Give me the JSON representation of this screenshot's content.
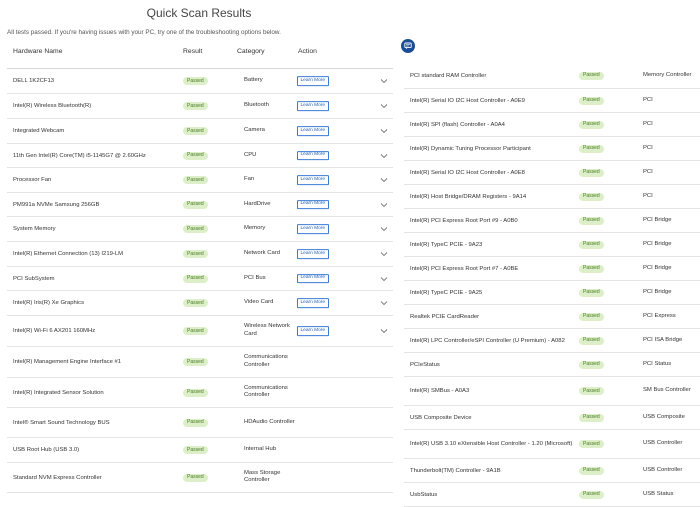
{
  "page": {
    "title": "Quick Scan Results",
    "subtitle": "All tests passed. If you're having issues with your PC, try one of the troubleshooting options below."
  },
  "table": {
    "headers": {
      "name": "Hardware Name",
      "result": "Result",
      "category": "Category",
      "action": "Action"
    },
    "learn_more_label": "Learn More"
  },
  "left_rows": [
    {
      "name": "DELL 1K2CF13",
      "result": "Passed",
      "category": "Battery",
      "learn_more": true,
      "expand": true,
      "h": 24
    },
    {
      "name": "Intel(R) Wireless Bluetooth(R)",
      "result": "Passed",
      "category": "Bluetooth",
      "learn_more": true,
      "expand": true,
      "h": 24
    },
    {
      "name": "Integrated Webcam",
      "result": "Passed",
      "category": "Camera",
      "learn_more": true,
      "expand": true,
      "h": 24
    },
    {
      "name": "11th Gen Intel(R) Core(TM) i5-1145G7 @ 2.60GHz",
      "result": "Passed",
      "category": "CPU",
      "learn_more": true,
      "expand": true,
      "h": 23
    },
    {
      "name": "Processor Fan",
      "result": "Passed",
      "category": "Fan",
      "learn_more": true,
      "expand": true,
      "h": 24
    },
    {
      "name": "PM991a NVMe Samsung 256GB",
      "result": "Passed",
      "category": "HardDrive",
      "learn_more": true,
      "expand": true,
      "h": 23
    },
    {
      "name": "System Memory",
      "result": "Passed",
      "category": "Memory",
      "learn_more": true,
      "expand": true,
      "h": 24
    },
    {
      "name": "Intel(R) Ethernet Connection (13) I219-LM",
      "result": "Passed",
      "category": "Network Card",
      "learn_more": true,
      "expand": true,
      "h": 24
    },
    {
      "name": "PCI SubSystem",
      "result": "Passed",
      "category": "PCI Bus",
      "learn_more": true,
      "expand": true,
      "h": 23
    },
    {
      "name": "Intel(R) Iris(R) Xe Graphics",
      "result": "Passed",
      "category": "Video Card",
      "learn_more": true,
      "expand": true,
      "h": 24
    },
    {
      "name": "Intel(R) Wi-Fi 6 AX201 160MHz",
      "result": "Passed",
      "category": "Wireless Network Card",
      "learn_more": true,
      "expand": true,
      "h": 30
    },
    {
      "name": "Intel(R) Management Engine Interface #1",
      "result": "Passed",
      "category": "Communications Controller",
      "learn_more": false,
      "expand": false,
      "h": 30
    },
    {
      "name": "Intel(R) Integrated Sensor Solution",
      "result": "Passed",
      "category": "Communications Controller",
      "learn_more": false,
      "expand": false,
      "h": 29
    },
    {
      "name": "Intel® Smart Sound Technology BUS",
      "result": "Passed",
      "category": "HDAudio Controller",
      "learn_more": false,
      "expand": false,
      "h": 29
    },
    {
      "name": "USB Root Hub (USB 3.0)",
      "result": "Passed",
      "category": "Internal Hub",
      "learn_more": false,
      "expand": false,
      "h": 24
    },
    {
      "name": "Standard NVM Express Controller",
      "result": "Passed",
      "category": "Mass Storage Controller",
      "learn_more": false,
      "expand": false,
      "h": 29
    }
  ],
  "right_rows": [
    {
      "name": "PCI standard RAM Controller",
      "result": "Passed",
      "category": "Memory Controller",
      "h": 25
    },
    {
      "name": "Intel(R) Serial IO I2C Host Controller - A0E9",
      "result": "Passed",
      "category": "PCI",
      "h": 23
    },
    {
      "name": "Intel(R) SPI (flash) Controller - A0A4",
      "result": "Passed",
      "category": "PCI",
      "h": 23
    },
    {
      "name": "Intel(R) Dynamic Tuning Processor Participant",
      "result": "Passed",
      "category": "PCI",
      "h": 23
    },
    {
      "name": "Intel(R) Serial IO I2C Host Controller - A0E8",
      "result": "Passed",
      "category": "PCI",
      "h": 23
    },
    {
      "name": "Intel(R) Host Bridge/DRAM Registers - 9A14",
      "result": "Passed",
      "category": "PCI",
      "h": 23
    },
    {
      "name": "Intel(R) PCI Express Root Port #9 - A0B0",
      "result": "Passed",
      "category": "PCI Bridge",
      "h": 23
    },
    {
      "name": "Intel(R) TypeC PCIE - 9A23",
      "result": "Passed",
      "category": "PCI Bridge",
      "h": 23
    },
    {
      "name": "Intel(R) PCI Express Root Port #7 - A0BE",
      "result": "Passed",
      "category": "PCI Bridge",
      "h": 23
    },
    {
      "name": "Intel(R) TypeC PCIE - 9A25",
      "result": "Passed",
      "category": "PCI Bridge",
      "h": 23
    },
    {
      "name": "Realtek PCIE CardReader",
      "result": "Passed",
      "category": "PCI Express",
      "h": 23
    },
    {
      "name": "Intel(R) LPC Controller/eSPI Controller (U Premium) - A082",
      "result": "Passed",
      "category": "PCI ISA Bridge",
      "h": 23
    },
    {
      "name": "PCIeStatus",
      "result": "Passed",
      "category": "PCI Status",
      "h": 23
    },
    {
      "name": "Intel(R) SMBus - A0A3",
      "result": "Passed",
      "category": "SM Bus Controller",
      "h": 28
    },
    {
      "name": "USB Composite Device",
      "result": "Passed",
      "category": "USB Composite",
      "h": 23
    },
    {
      "name": "Intel(R) USB 3.10 eXtensible Host Controller - 1.20 (Microsoft)",
      "result": "Passed",
      "category": "USB Controller",
      "h": 28
    },
    {
      "name": "Thunderbolt(TM) Controller - 9A1B",
      "result": "Passed",
      "category": "USB Controller",
      "h": 23
    },
    {
      "name": "UsbStatus",
      "result": "Passed",
      "category": "USB Status",
      "h": 23
    }
  ],
  "colors": {
    "badge_bg": "#dcefc9",
    "badge_text": "#4c7a24",
    "link": "#1f5fb8",
    "feedback_button": "#1c4e97"
  },
  "icons": {
    "feedback": "chat-icon",
    "expand": "chevron-down-icon"
  }
}
